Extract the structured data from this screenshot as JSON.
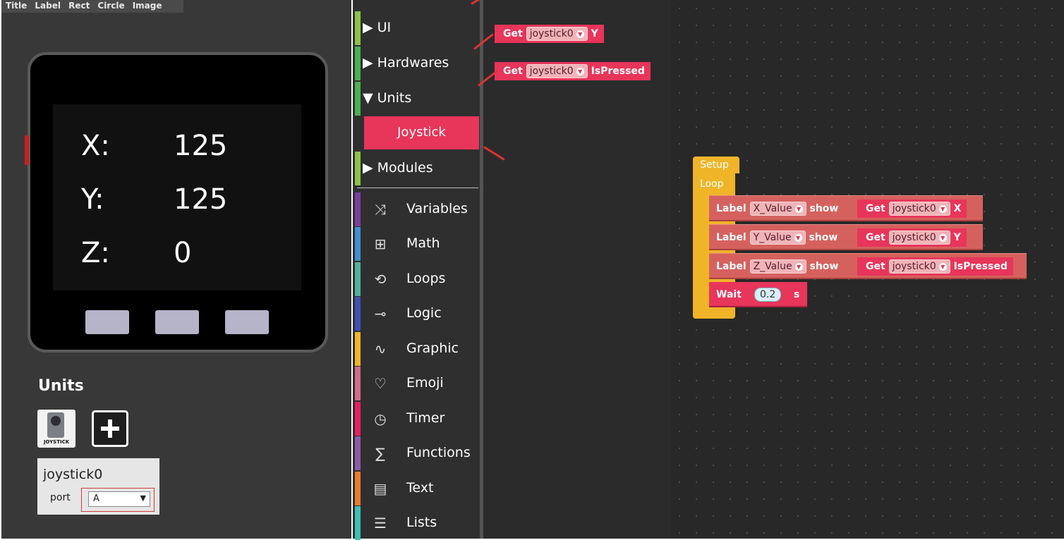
{
  "toolbar": {
    "items": [
      "Title",
      "Label",
      "Rect",
      "Circle",
      "Image"
    ]
  },
  "device": {
    "readouts": [
      {
        "label": "X:",
        "value": "125"
      },
      {
        "label": "Y:",
        "value": "125"
      },
      {
        "label": "Z:",
        "value": "0"
      }
    ]
  },
  "units_panel": {
    "title": "Units",
    "thumb_label": "JOYSTICK",
    "unit_name": "joystick0",
    "port_label": "port",
    "port_value": "A"
  },
  "menu": {
    "groups": [
      {
        "label": "▶ UI",
        "color": "#8bc34a"
      },
      {
        "label": "▶ Hardwares",
        "color": "#4caf50"
      },
      {
        "label": "▼ Units",
        "color": "#4caf50"
      },
      {
        "label": "▶ Modules",
        "color": "#8bc34a"
      }
    ],
    "selected_sub": "Joystick",
    "categories": [
      {
        "label": "Variables",
        "icon": "variables-icon",
        "color": "#7b3fa0"
      },
      {
        "label": "Math",
        "icon": "math-icon",
        "color": "#3f8fd0"
      },
      {
        "label": "Loops",
        "icon": "loops-icon",
        "color": "#4fb39a"
      },
      {
        "label": "Logic",
        "icon": "logic-icon",
        "color": "#3f51b5"
      },
      {
        "label": "Graphic",
        "icon": "graphic-icon",
        "color": "#f0b429"
      },
      {
        "label": "Emoji",
        "icon": "emoji-icon",
        "color": "#d06b8a"
      },
      {
        "label": "Timer",
        "icon": "timer-icon",
        "color": "#e91e63"
      },
      {
        "label": "Functions",
        "icon": "functions-icon",
        "color": "#8e5aa8"
      },
      {
        "label": "Text",
        "icon": "text-icon",
        "color": "#e87c2c"
      },
      {
        "label": "Lists",
        "icon": "lists-icon",
        "color": "#3fbfb0"
      }
    ]
  },
  "flyout": {
    "blocks": [
      {
        "get": "Get",
        "unit": "joystick0",
        "prop": "Y"
      },
      {
        "get": "Get",
        "unit": "joystick0",
        "prop": "IsPressed"
      }
    ]
  },
  "workspace": {
    "setup_label": "Setup",
    "loop_label": "Loop",
    "rows": [
      {
        "label": "Label",
        "target": "X_Value",
        "show": "show",
        "get": "Get",
        "unit": "joystick0",
        "prop": "X"
      },
      {
        "label": "Label",
        "target": "Y_Value",
        "show": "show",
        "get": "Get",
        "unit": "joystick0",
        "prop": "Y"
      },
      {
        "label": "Label",
        "target": "Z_Value",
        "show": "show",
        "get": "Get",
        "unit": "joystick0",
        "prop": "IsPressed"
      }
    ],
    "wait_label": "Wait",
    "wait_value": "0.2",
    "wait_unit": "s"
  },
  "colors": {
    "accent_pink": "#e8355a",
    "label_block": "#d5615e",
    "setup_block": "#f0b429"
  }
}
